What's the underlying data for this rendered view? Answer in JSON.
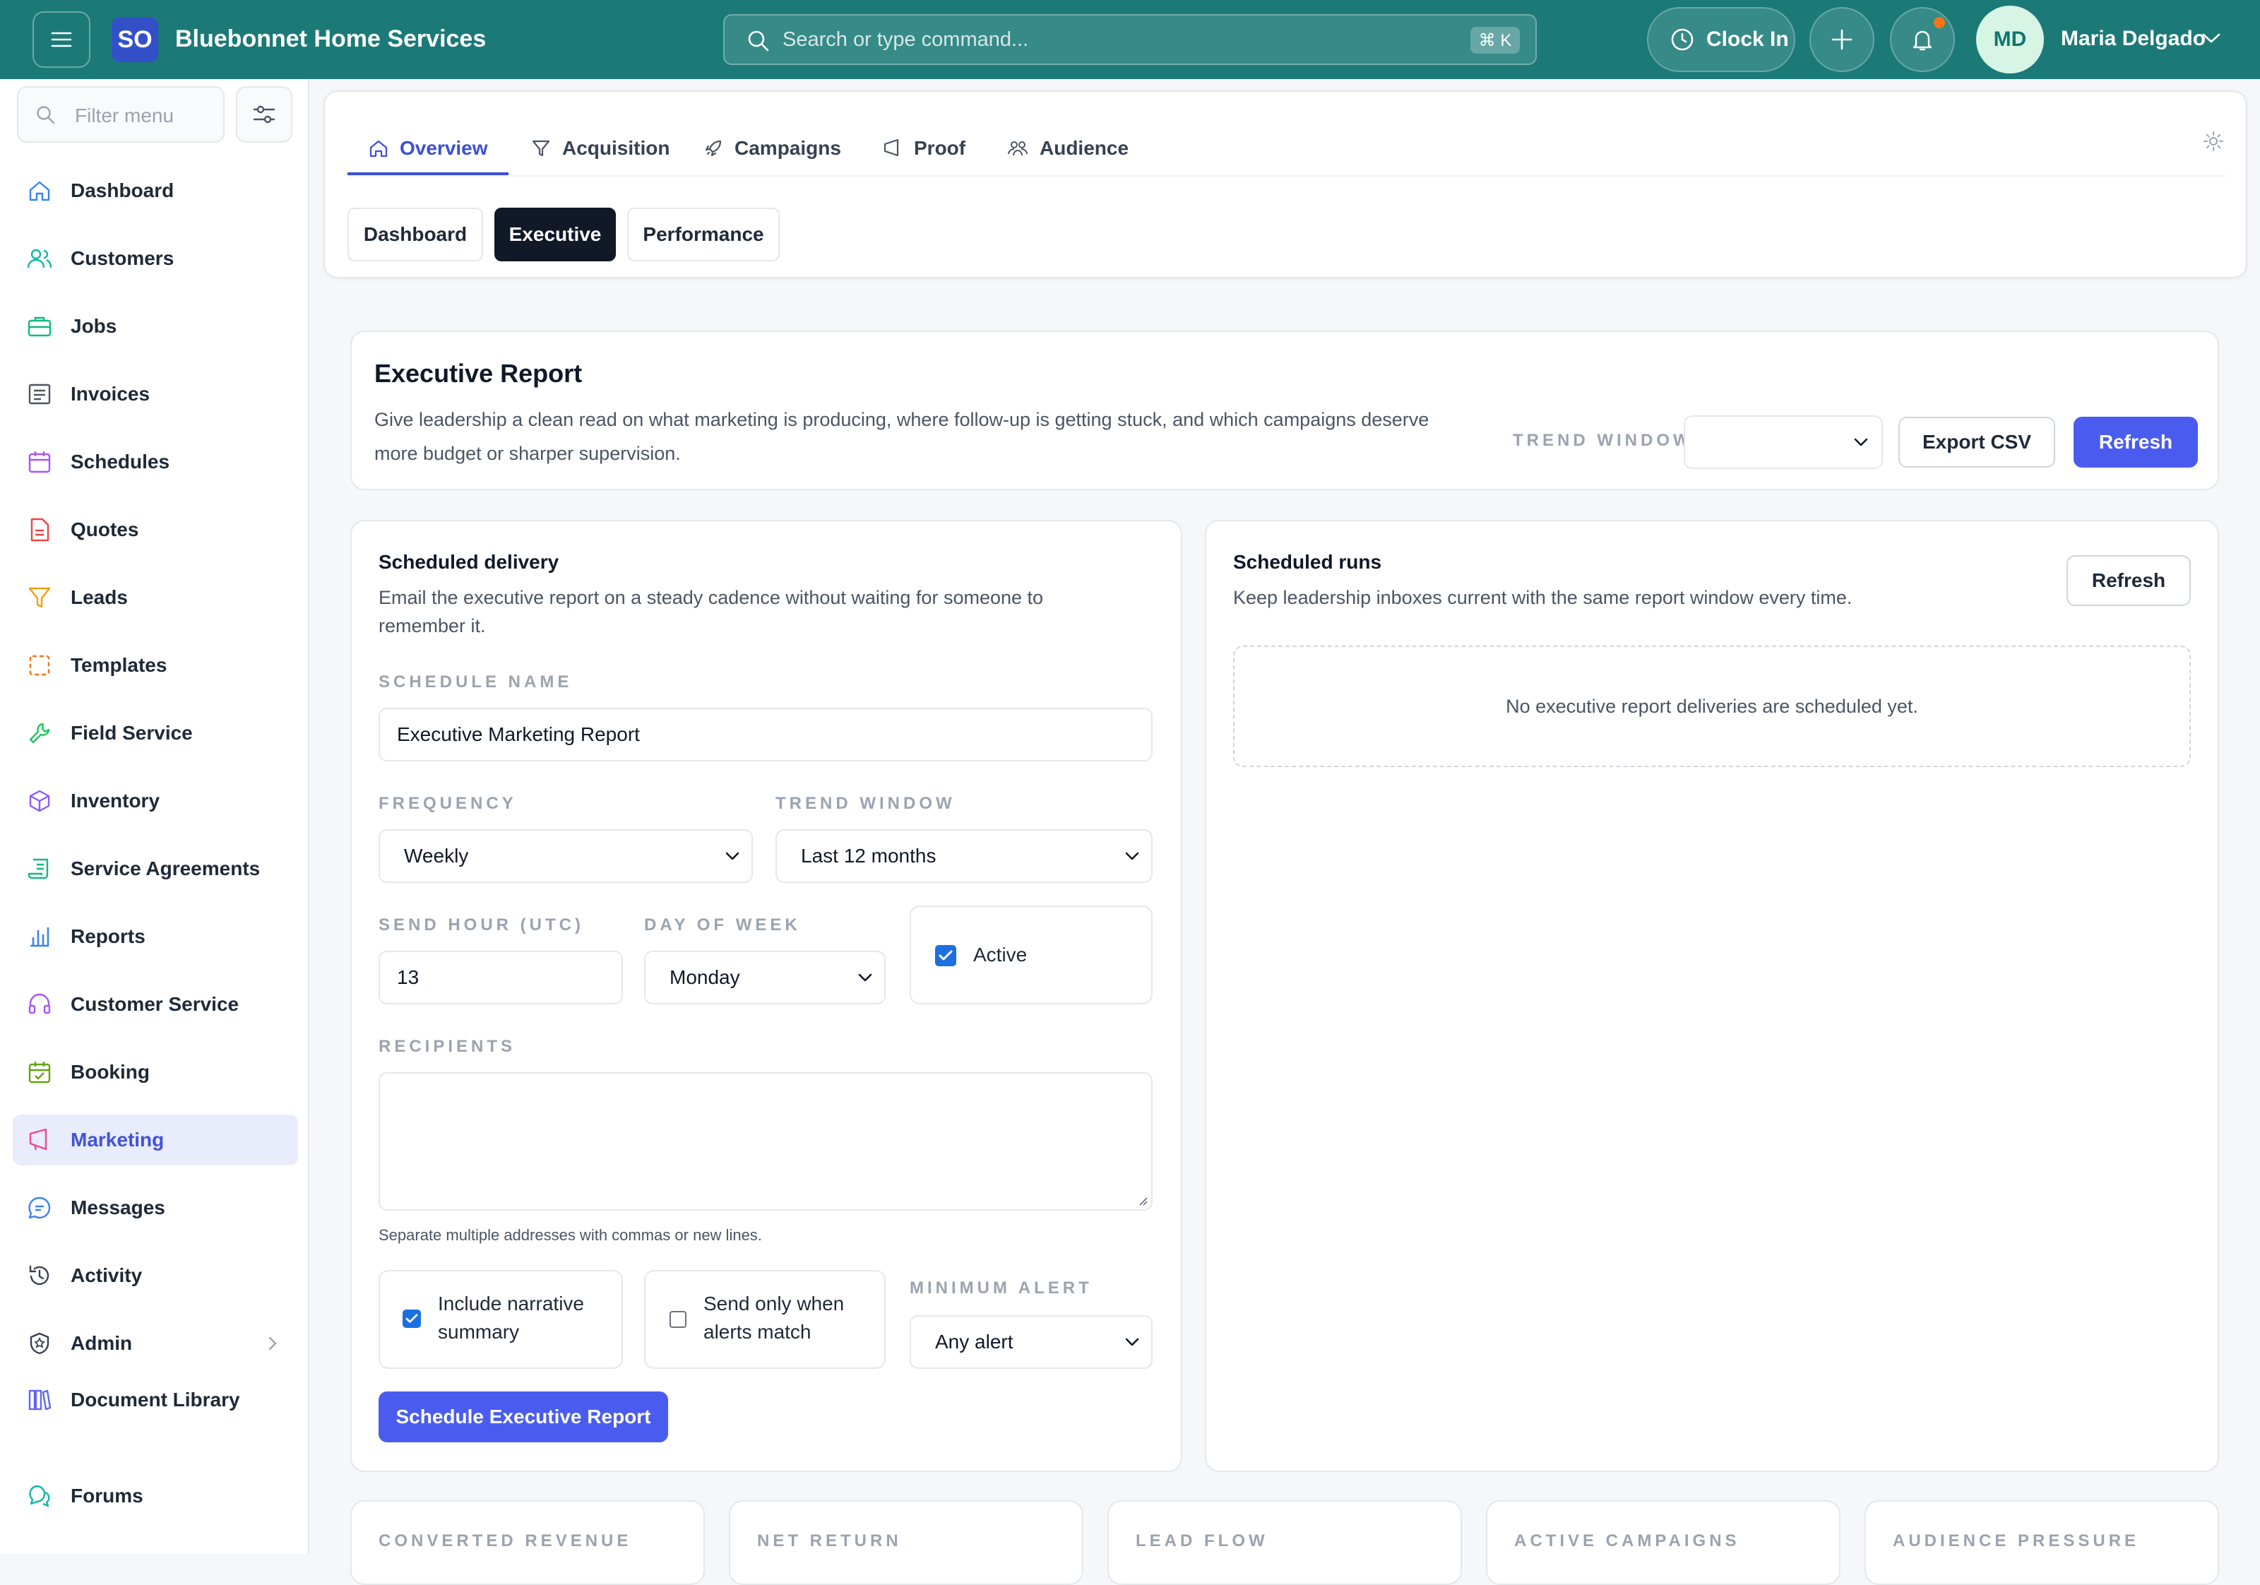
{
  "app": {
    "logo_initials": "SO",
    "brand_name": "Bluebonnet Home Services",
    "search_placeholder": "Search or type command...",
    "search_shortcut": "⌘ K",
    "clock_in_label": "Clock In",
    "user_initials": "MD",
    "user_name": "Maria Delgado"
  },
  "sidebar": {
    "filter_placeholder": "Filter menu",
    "items": [
      {
        "label": "Dashboard",
        "icon": "home-icon"
      },
      {
        "label": "Customers",
        "icon": "users-icon"
      },
      {
        "label": "Jobs",
        "icon": "briefcase-icon"
      },
      {
        "label": "Invoices",
        "icon": "invoice-icon"
      },
      {
        "label": "Schedules",
        "icon": "calendar-icon"
      },
      {
        "label": "Quotes",
        "icon": "document-icon"
      },
      {
        "label": "Leads",
        "icon": "funnel-icon"
      },
      {
        "label": "Templates",
        "icon": "template-icon"
      },
      {
        "label": "Field Service",
        "icon": "wrench-icon"
      },
      {
        "label": "Inventory",
        "icon": "box-icon"
      },
      {
        "label": "Service Agreements",
        "icon": "scroll-icon"
      },
      {
        "label": "Reports",
        "icon": "bar-chart-icon"
      },
      {
        "label": "Customer Service",
        "icon": "headset-icon"
      },
      {
        "label": "Booking",
        "icon": "calendar-check-icon"
      },
      {
        "label": "Marketing",
        "icon": "megaphone-icon"
      },
      {
        "label": "Messages",
        "icon": "chat-icon"
      },
      {
        "label": "Activity",
        "icon": "history-icon"
      },
      {
        "label": "Admin",
        "icon": "shield-icon"
      },
      {
        "label": "Document Library",
        "icon": "library-icon"
      },
      {
        "label": "Forums",
        "icon": "forum-icon"
      }
    ],
    "active": "Marketing",
    "accent_color": "#4252d9"
  },
  "tabs": {
    "items": [
      "Overview",
      "Acquisition",
      "Campaigns",
      "Proof",
      "Audience"
    ],
    "active": "Overview",
    "subtabs": [
      "Dashboard",
      "Executive",
      "Performance"
    ],
    "active_subtab": "Executive"
  },
  "report": {
    "title": "Executive Report",
    "description": "Give leadership a clean read on what marketing is producing, where follow-up is getting stuck, and which campaigns deserve more budget or sharper supervision.",
    "trend_window_label": "TREND WINDOW",
    "trend_window_value": "",
    "export_label": "Export CSV",
    "refresh_label": "Refresh"
  },
  "scheduled_delivery": {
    "title": "Scheduled delivery",
    "description": "Email the executive report on a steady cadence without waiting for someone to remember it.",
    "schedule_name_label": "SCHEDULE NAME",
    "schedule_name_value": "Executive Marketing Report",
    "frequency_label": "FREQUENCY",
    "frequency_value": "Weekly",
    "trend_window_label": "TREND WINDOW",
    "trend_window_value": "Last 12 months",
    "send_hour_label": "SEND HOUR (UTC)",
    "send_hour_value": "13",
    "day_of_week_label": "DAY OF WEEK",
    "day_of_week_value": "Monday",
    "active_label": "Active",
    "active_checked": true,
    "recipients_label": "RECIPIENTS",
    "recipients_value": "",
    "recipients_hint": "Separate multiple addresses with commas or new lines.",
    "narrative_label": "Include narrative summary",
    "narrative_checked": true,
    "alerts_only_label": "Send only when alerts match",
    "alerts_only_checked": false,
    "minimum_alert_label": "MINIMUM ALERT",
    "minimum_alert_value": "Any alert",
    "submit_label": "Schedule Executive Report"
  },
  "scheduled_runs": {
    "title": "Scheduled runs",
    "description": "Keep leadership inboxes current with the same report window every time.",
    "refresh_label": "Refresh",
    "empty_message": "No executive report deliveries are scheduled yet."
  },
  "kpis": [
    "CONVERTED REVENUE",
    "NET RETURN",
    "LEAD FLOW",
    "ACTIVE CAMPAIGNS",
    "AUDIENCE PRESSURE"
  ]
}
